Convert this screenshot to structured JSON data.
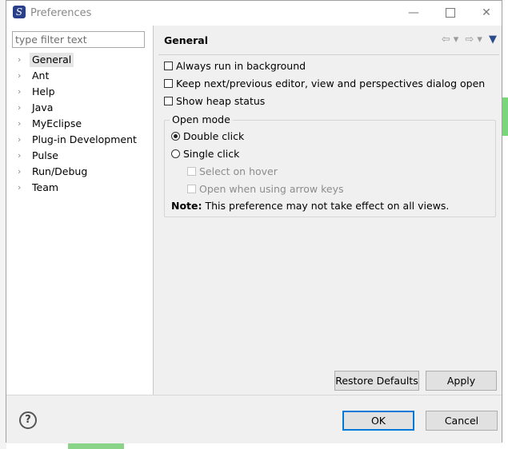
{
  "window": {
    "title": "Preferences",
    "app_icon_letter": "S"
  },
  "window_controls": {
    "minimize": "—",
    "close": "✕"
  },
  "filter": {
    "placeholder": "type filter text",
    "value": ""
  },
  "tree": [
    {
      "label": "General",
      "selected": true
    },
    {
      "label": "Ant"
    },
    {
      "label": "Help"
    },
    {
      "label": "Java"
    },
    {
      "label": "MyEclipse"
    },
    {
      "label": "Plug-in Development"
    },
    {
      "label": "Pulse"
    },
    {
      "label": "Run/Debug"
    },
    {
      "label": "Team"
    }
  ],
  "page": {
    "title": "General",
    "nav": {
      "back": "⇦",
      "back_menu": "▾",
      "forward": "⇨",
      "forward_menu": "▾",
      "view_menu": "▼"
    },
    "checkboxes": [
      {
        "label": "Always run in background",
        "checked": false
      },
      {
        "label": "Keep next/previous editor, view and perspectives dialog open",
        "checked": false
      },
      {
        "label": "Show heap status",
        "checked": false
      }
    ],
    "open_mode": {
      "label": "Open mode",
      "double_click": "Double click",
      "single_click": "Single click",
      "select_on_hover": "Select on hover",
      "open_arrow_keys": "Open when using arrow keys",
      "note_label": "Note:",
      "note_text": " This preference may not take effect on all views."
    },
    "restore_defaults": "Restore Defaults",
    "apply": "Apply"
  },
  "footer": {
    "help": "?",
    "ok": "OK",
    "cancel": "Cancel"
  }
}
